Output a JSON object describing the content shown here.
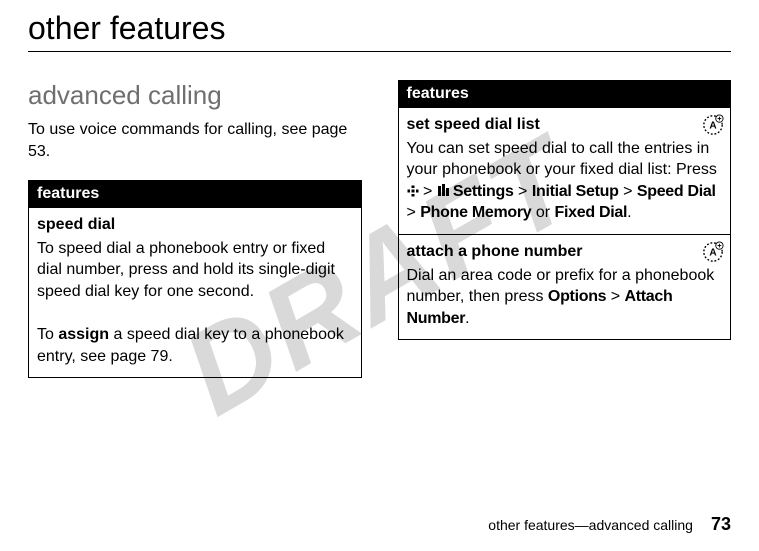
{
  "watermark": "DRAFT",
  "page_title": "other features",
  "section_title": "advanced calling",
  "intro_text": "To use voice commands for calling, see page 53.",
  "left_table": {
    "header": "features",
    "rows": [
      {
        "name": "speed dial",
        "body1": "To speed dial a phonebook entry or fixed dial number, press and hold its single-digit speed dial key for one second.",
        "body2_pre": "To ",
        "body2_bold": "assign",
        "body2_post": " a speed dial key to a phonebook entry, see page 79."
      }
    ]
  },
  "right_table": {
    "header": "features",
    "rows": [
      {
        "name": "set speed dial list",
        "body_pre": "You can set speed dial to call the entries in your phonebook or your fixed dial list: Press ",
        "nav_icon": "center-key-icon",
        "gt1": " > ",
        "settings_icon": "settings-icon",
        "settings_label": " Settings",
        "gt2": " > ",
        "initial_setup": "Initial Setup",
        "gt3": " > ",
        "speed_dial": "Speed Dial",
        "gt4": " > ",
        "phone_memory": "Phone Memory",
        "or": " or ",
        "fixed_dial": "Fixed Dial",
        "period": ".",
        "has_badge": true
      },
      {
        "name": "attach a phone number",
        "body_pre": "Dial an area code or prefix for a phonebook number, then press ",
        "options": "Options",
        "gt": " > ",
        "attach": "Attach Number",
        "period": ".",
        "has_badge": true
      }
    ]
  },
  "footer_text": "other features—advanced calling",
  "page_number": "73"
}
